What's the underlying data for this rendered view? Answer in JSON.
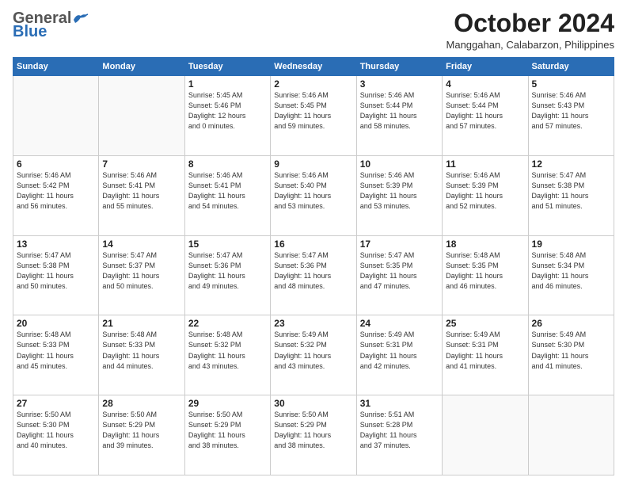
{
  "header": {
    "logo_general": "General",
    "logo_blue": "Blue",
    "month_title": "October 2024",
    "location": "Manggahan, Calabarzon, Philippines"
  },
  "weekdays": [
    "Sunday",
    "Monday",
    "Tuesday",
    "Wednesday",
    "Thursday",
    "Friday",
    "Saturday"
  ],
  "weeks": [
    [
      {
        "day": "",
        "info": ""
      },
      {
        "day": "",
        "info": ""
      },
      {
        "day": "1",
        "info": "Sunrise: 5:45 AM\nSunset: 5:46 PM\nDaylight: 12 hours\nand 0 minutes."
      },
      {
        "day": "2",
        "info": "Sunrise: 5:46 AM\nSunset: 5:45 PM\nDaylight: 11 hours\nand 59 minutes."
      },
      {
        "day": "3",
        "info": "Sunrise: 5:46 AM\nSunset: 5:44 PM\nDaylight: 11 hours\nand 58 minutes."
      },
      {
        "day": "4",
        "info": "Sunrise: 5:46 AM\nSunset: 5:44 PM\nDaylight: 11 hours\nand 57 minutes."
      },
      {
        "day": "5",
        "info": "Sunrise: 5:46 AM\nSunset: 5:43 PM\nDaylight: 11 hours\nand 57 minutes."
      }
    ],
    [
      {
        "day": "6",
        "info": "Sunrise: 5:46 AM\nSunset: 5:42 PM\nDaylight: 11 hours\nand 56 minutes."
      },
      {
        "day": "7",
        "info": "Sunrise: 5:46 AM\nSunset: 5:41 PM\nDaylight: 11 hours\nand 55 minutes."
      },
      {
        "day": "8",
        "info": "Sunrise: 5:46 AM\nSunset: 5:41 PM\nDaylight: 11 hours\nand 54 minutes."
      },
      {
        "day": "9",
        "info": "Sunrise: 5:46 AM\nSunset: 5:40 PM\nDaylight: 11 hours\nand 53 minutes."
      },
      {
        "day": "10",
        "info": "Sunrise: 5:46 AM\nSunset: 5:39 PM\nDaylight: 11 hours\nand 53 minutes."
      },
      {
        "day": "11",
        "info": "Sunrise: 5:46 AM\nSunset: 5:39 PM\nDaylight: 11 hours\nand 52 minutes."
      },
      {
        "day": "12",
        "info": "Sunrise: 5:47 AM\nSunset: 5:38 PM\nDaylight: 11 hours\nand 51 minutes."
      }
    ],
    [
      {
        "day": "13",
        "info": "Sunrise: 5:47 AM\nSunset: 5:38 PM\nDaylight: 11 hours\nand 50 minutes."
      },
      {
        "day": "14",
        "info": "Sunrise: 5:47 AM\nSunset: 5:37 PM\nDaylight: 11 hours\nand 50 minutes."
      },
      {
        "day": "15",
        "info": "Sunrise: 5:47 AM\nSunset: 5:36 PM\nDaylight: 11 hours\nand 49 minutes."
      },
      {
        "day": "16",
        "info": "Sunrise: 5:47 AM\nSunset: 5:36 PM\nDaylight: 11 hours\nand 48 minutes."
      },
      {
        "day": "17",
        "info": "Sunrise: 5:47 AM\nSunset: 5:35 PM\nDaylight: 11 hours\nand 47 minutes."
      },
      {
        "day": "18",
        "info": "Sunrise: 5:48 AM\nSunset: 5:35 PM\nDaylight: 11 hours\nand 46 minutes."
      },
      {
        "day": "19",
        "info": "Sunrise: 5:48 AM\nSunset: 5:34 PM\nDaylight: 11 hours\nand 46 minutes."
      }
    ],
    [
      {
        "day": "20",
        "info": "Sunrise: 5:48 AM\nSunset: 5:33 PM\nDaylight: 11 hours\nand 45 minutes."
      },
      {
        "day": "21",
        "info": "Sunrise: 5:48 AM\nSunset: 5:33 PM\nDaylight: 11 hours\nand 44 minutes."
      },
      {
        "day": "22",
        "info": "Sunrise: 5:48 AM\nSunset: 5:32 PM\nDaylight: 11 hours\nand 43 minutes."
      },
      {
        "day": "23",
        "info": "Sunrise: 5:49 AM\nSunset: 5:32 PM\nDaylight: 11 hours\nand 43 minutes."
      },
      {
        "day": "24",
        "info": "Sunrise: 5:49 AM\nSunset: 5:31 PM\nDaylight: 11 hours\nand 42 minutes."
      },
      {
        "day": "25",
        "info": "Sunrise: 5:49 AM\nSunset: 5:31 PM\nDaylight: 11 hours\nand 41 minutes."
      },
      {
        "day": "26",
        "info": "Sunrise: 5:49 AM\nSunset: 5:30 PM\nDaylight: 11 hours\nand 41 minutes."
      }
    ],
    [
      {
        "day": "27",
        "info": "Sunrise: 5:50 AM\nSunset: 5:30 PM\nDaylight: 11 hours\nand 40 minutes."
      },
      {
        "day": "28",
        "info": "Sunrise: 5:50 AM\nSunset: 5:29 PM\nDaylight: 11 hours\nand 39 minutes."
      },
      {
        "day": "29",
        "info": "Sunrise: 5:50 AM\nSunset: 5:29 PM\nDaylight: 11 hours\nand 38 minutes."
      },
      {
        "day": "30",
        "info": "Sunrise: 5:50 AM\nSunset: 5:29 PM\nDaylight: 11 hours\nand 38 minutes."
      },
      {
        "day": "31",
        "info": "Sunrise: 5:51 AM\nSunset: 5:28 PM\nDaylight: 11 hours\nand 37 minutes."
      },
      {
        "day": "",
        "info": ""
      },
      {
        "day": "",
        "info": ""
      }
    ]
  ]
}
